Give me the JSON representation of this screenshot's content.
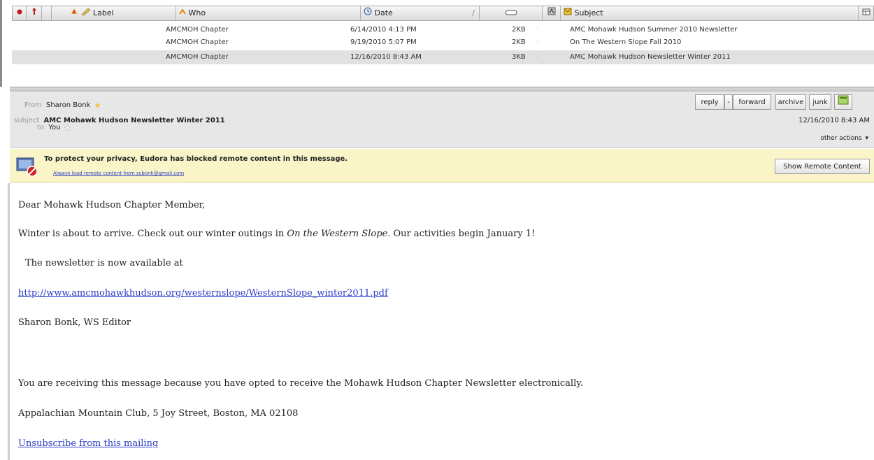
{
  "list": {
    "columns": {
      "label": "Label",
      "who": "Who",
      "date": "Date",
      "subject": "Subject"
    },
    "rows": [
      {
        "who": "AMCMOH Chapter",
        "date": "6/14/2010 4:13 PM",
        "size": "2KB",
        "subject": "AMC Mohawk Hudson Summer 2010 Newsletter",
        "selected": false
      },
      {
        "who": "AMCMOH Chapter",
        "date": "9/19/2010 5:07 PM",
        "size": "2KB",
        "subject": "On The Western Slope Fall 2010",
        "selected": false
      },
      {
        "who": "AMCMOH Chapter",
        "date": "12/16/2010 8:43 AM",
        "size": "3KB",
        "subject": "AMC Mohawk Hudson Newsletter Winter 2011",
        "selected": true
      }
    ]
  },
  "message": {
    "from_label": "From",
    "from": "Sharon Bonk",
    "subject_label": "subject",
    "subject": "AMC Mohawk Hudson Newsletter Winter 2011",
    "to_label": "to",
    "to": "You",
    "date": "12/16/2010 8:43 AM",
    "actions": {
      "reply": "reply",
      "forward": "forward",
      "archive": "archive",
      "junk": "junk",
      "other": "other actions"
    }
  },
  "privacy": {
    "message": "To protect your privacy, Eudora has blocked remote content in this message.",
    "link": "Always load remote content from scbonk@gmail.com",
    "button": "Show Remote Content"
  },
  "body": {
    "greeting": "Dear Mohawk Hudson Chapter Member,",
    "line1_a": "Winter is about to arrive. Check out our winter outings in ",
    "line1_em": "On the Western Slope",
    "line1_b": ".  Our activities begin January 1!",
    "line2": "The newsletter is now available at",
    "url": "http://www.amcmohawkhudson.org/westernslope/WesternSlope_winter2011.pdf",
    "signature": "Sharon Bonk, WS Editor",
    "notice": "You are receiving this message because you have opted to receive the Mohawk Hudson Chapter Newsletter electronically.",
    "address": "Appalachian Mountain Club, 5 Joy Street, Boston, MA 02108",
    "unsubscribe": "Unsubscribe from this mailing"
  },
  "colors": {
    "privacy_bar": "#f9f5c9",
    "link": "#2a3cc8",
    "selected_row": "#e1e1e1"
  }
}
